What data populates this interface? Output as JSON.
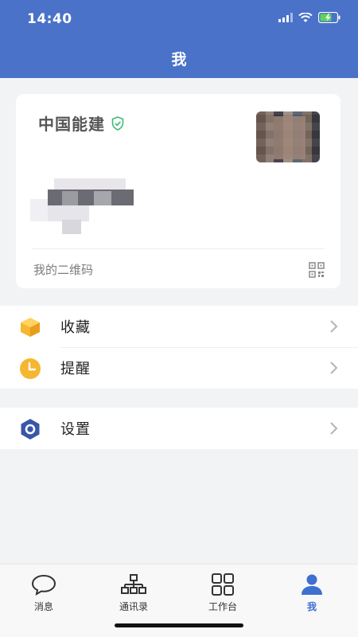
{
  "status_bar": {
    "time": "14:40"
  },
  "header": {
    "title": "我"
  },
  "profile": {
    "org_name": "中国能建",
    "verified_icon": "shield-check-icon",
    "qr_label": "我的二维码",
    "qr_icon": "qr-code-icon"
  },
  "menu_group_1": [
    {
      "label": "收藏",
      "icon": "box-icon",
      "color": "#f5b731"
    },
    {
      "label": "提醒",
      "icon": "clock-icon",
      "color": "#f5b731"
    }
  ],
  "menu_group_2": [
    {
      "label": "设置",
      "icon": "hexagon-settings-icon",
      "color": "#3a56a8"
    }
  ],
  "tabbar": {
    "tabs": [
      {
        "label": "消息",
        "icon": "chat-bubble-icon"
      },
      {
        "label": "通讯录",
        "icon": "org-chart-icon"
      },
      {
        "label": "工作台",
        "icon": "grid-icon"
      },
      {
        "label": "我",
        "icon": "person-icon",
        "active": true
      }
    ]
  },
  "colors": {
    "primary": "#4a72c8",
    "accent": "#3f6fcf",
    "verified": "#3dbb73"
  }
}
